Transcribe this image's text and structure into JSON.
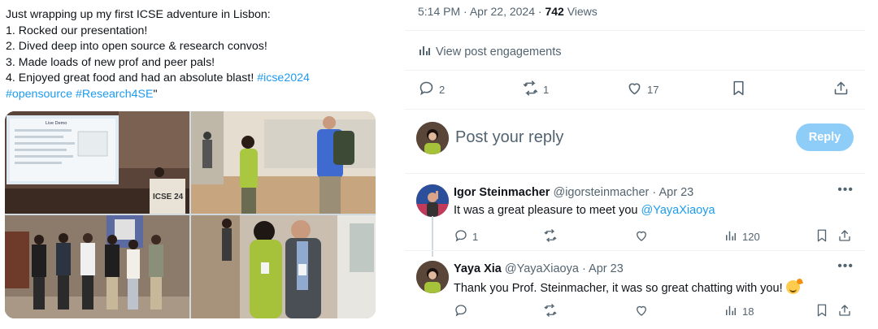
{
  "tweet": {
    "lines": [
      "Just wrapping up my first ICSE adventure in Lisbon:",
      "1. Rocked our presentation!",
      "2. Dived deep into open source & research convos!",
      "3. Made loads of new prof and peer pals!"
    ],
    "line5_text": "4. Enjoyed great food and had an absolute blast! ",
    "line5_tag": "#icse2024",
    "line6_tag1": "#opensource",
    "line6_tag2": "#Research4SE",
    "line6_end": "\"",
    "photos": {
      "slide_title": "Live Demo",
      "podium_label": "ICSE 24"
    }
  },
  "post_meta": {
    "time": "5:14 PM",
    "separator": "·",
    "date": "Apr 22, 2024",
    "views_count": "742",
    "views_label": "Views"
  },
  "engagements_label": "View post engagements",
  "actions": {
    "replies": "2",
    "reposts": "1",
    "likes": "17"
  },
  "reply_composer": {
    "placeholder": "Post your reply",
    "button": "Reply"
  },
  "replies": [
    {
      "name": "Igor Steinmacher",
      "handle": "@igorsteinmacher",
      "date": "Apr 23",
      "text": "It was a great pleasure to meet you ",
      "mention": "@YayaXiaoya",
      "replies": "1",
      "views": "120"
    },
    {
      "name": "Yaya Xia",
      "handle": "@YayaXiaoya",
      "date": "Apr 23",
      "text": "Thank you Prof. Steinmacher, it was so great chatting with you! ",
      "views": "18"
    }
  ],
  "colors": {
    "accent": "#1d9bf0",
    "muted": "#536471",
    "reply_button": "#8ecdf7"
  },
  "icons": [
    "bar-chart-icon",
    "reply-icon",
    "repost-icon",
    "like-icon",
    "bookmark-icon",
    "share-icon",
    "more-icon",
    "emoji-icon"
  ]
}
